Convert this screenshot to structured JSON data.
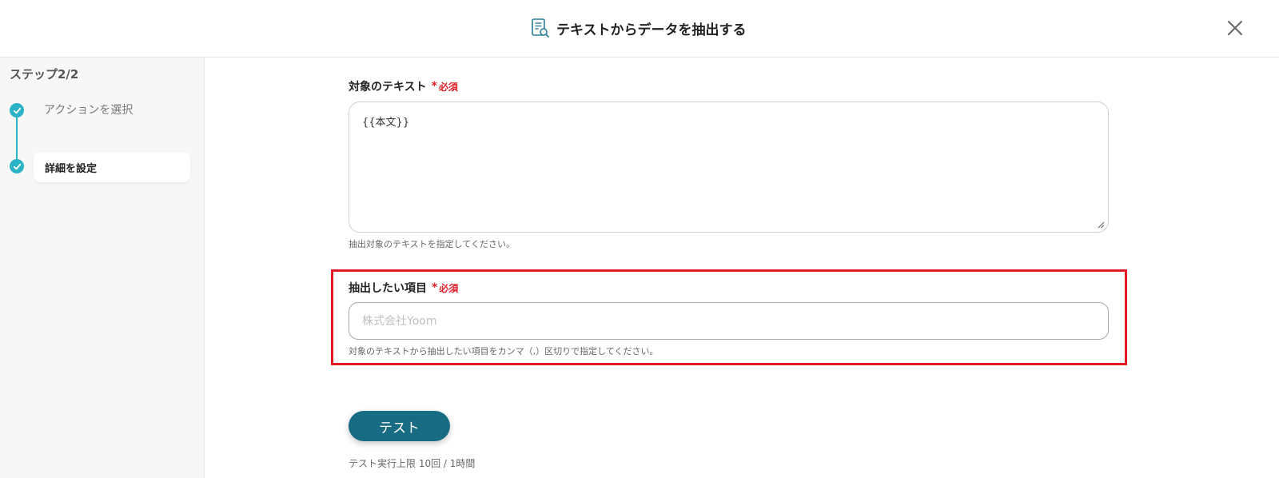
{
  "header": {
    "title": "テキストからデータを抽出する",
    "icon": "document-search-icon",
    "close_icon": "close-icon"
  },
  "sidebar": {
    "step_heading": "ステップ2/2",
    "steps": [
      {
        "label": "アクションを選択",
        "status": "done"
      },
      {
        "label": "詳細を設定",
        "status": "current"
      }
    ],
    "accent_color": "#2ab3c6"
  },
  "form": {
    "required_label": "必須",
    "required_mark": "*",
    "target_text": {
      "label": "対象のテキスト",
      "value": "{{本文}}",
      "hint": "抽出対象のテキストを指定してください。"
    },
    "extract_items": {
      "label": "抽出したい項目",
      "placeholder": "株式会社Yoom",
      "value": "",
      "hint": "対象のテキストから抽出したい項目をカンマ（,）区切りで指定してください。",
      "highlight_color": "#e01b24"
    }
  },
  "test": {
    "button_label": "テスト",
    "limit_text": "テスト実行上限 10回 / 1時間",
    "button_color": "#176b83"
  }
}
